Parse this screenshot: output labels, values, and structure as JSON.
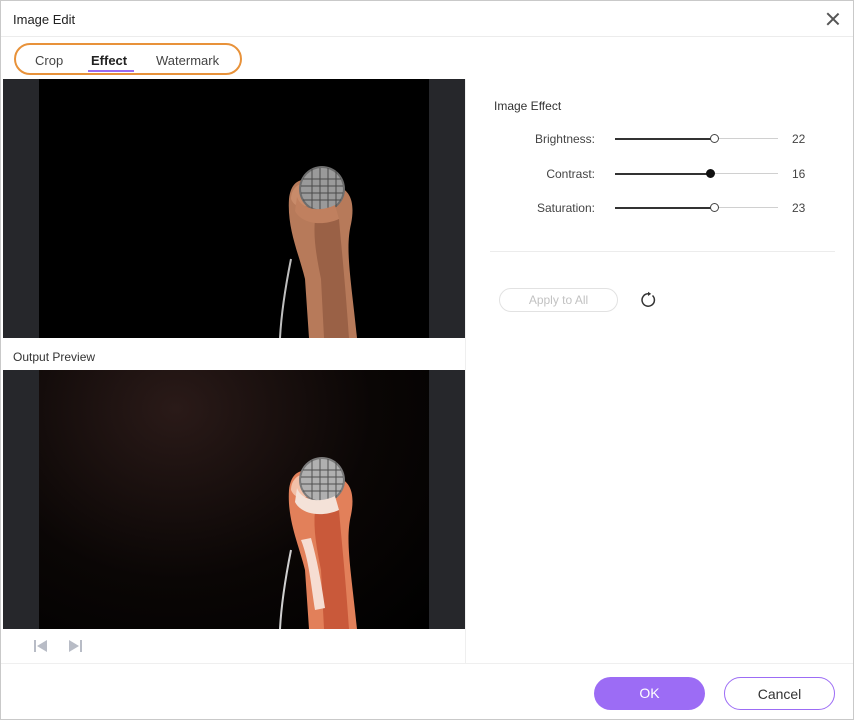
{
  "window": {
    "title": "Image Edit",
    "close_icon": "close-icon"
  },
  "tabs": [
    {
      "label": "Crop",
      "active": false
    },
    {
      "label": "Effect",
      "active": true
    },
    {
      "label": "Watermark",
      "active": false
    }
  ],
  "preview": {
    "output_label": "Output Preview",
    "image_subject": "hand holding microphone on black background"
  },
  "navigation": {
    "prev_icon": "skip-previous-icon",
    "next_icon": "skip-next-icon"
  },
  "effects": {
    "section_title": "Image Effect",
    "sliders": [
      {
        "label": "Brightness:",
        "value": "22",
        "level": 0.61,
        "thumb_style": "hollow"
      },
      {
        "label": "Contrast:",
        "value": "16",
        "level": 0.58,
        "thumb_style": "filled"
      },
      {
        "label": "Saturation:",
        "value": "23",
        "level": 0.61,
        "thumb_style": "hollow"
      }
    ],
    "apply_all_label": "Apply to All",
    "reset_icon": "reset-icon"
  },
  "footer": {
    "ok_label": "OK",
    "cancel_label": "Cancel"
  },
  "colors": {
    "accent": "#9c6cf5",
    "tab_highlight": "#e8923a",
    "preview_bg": "#26272b"
  }
}
